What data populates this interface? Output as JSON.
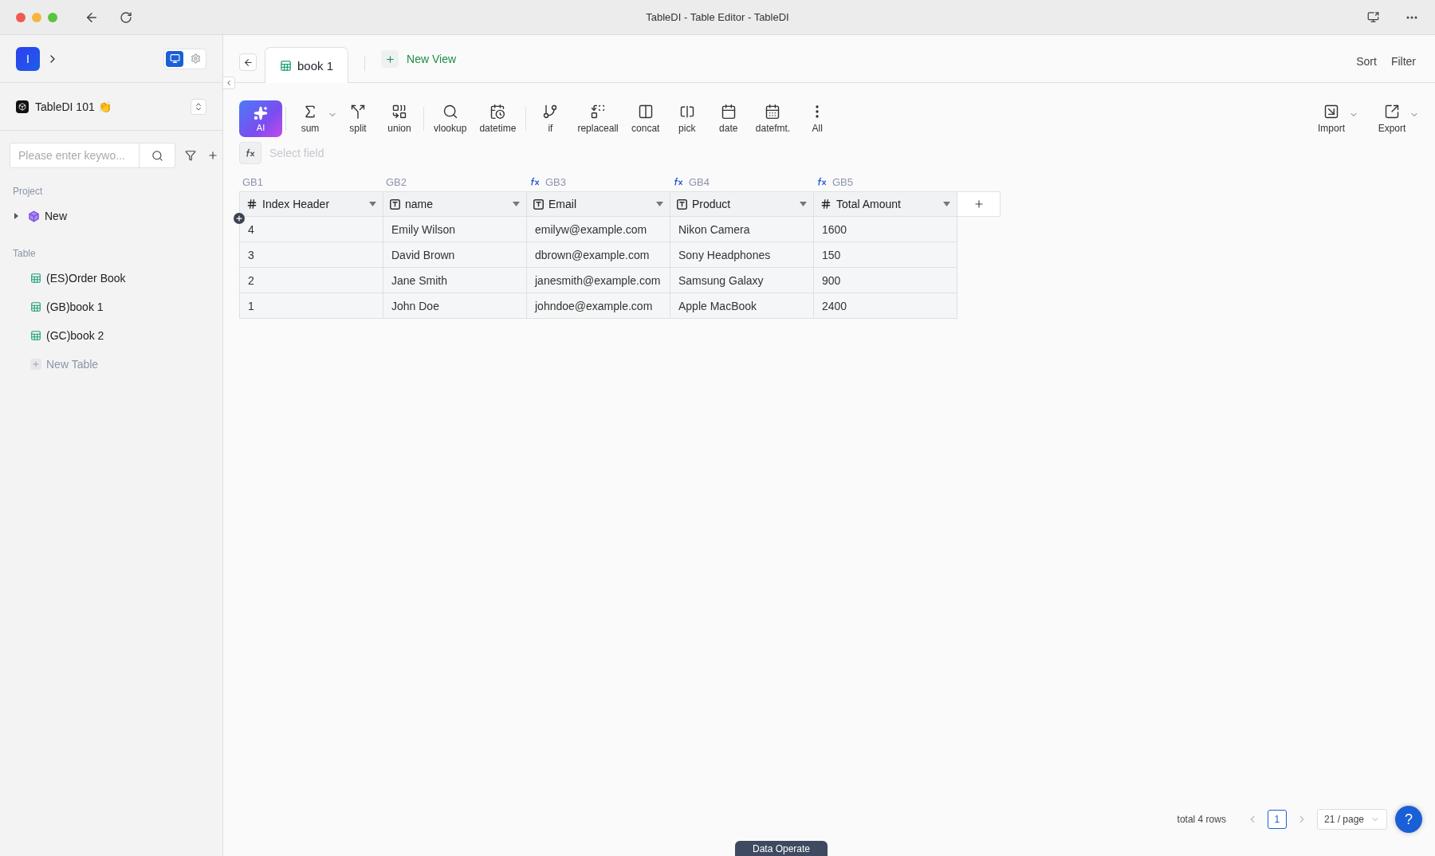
{
  "window": {
    "title": "TableDI - Table Editor - TableDI"
  },
  "sidebar": {
    "workspace": {
      "initial": "I"
    },
    "view_toggle": [
      {
        "selected": true
      },
      {
        "selected": false
      }
    ],
    "project": {
      "name": "TableDI 101 👏"
    },
    "search": {
      "placeholder": "Please enter keywo..."
    },
    "sections": [
      {
        "title": "Project",
        "items": [
          {
            "label": "New",
            "kind": "project",
            "expanded": false
          }
        ]
      },
      {
        "title": "Table",
        "items": [
          {
            "label": "(ES)Order Book",
            "kind": "table"
          },
          {
            "label": "(GB)book 1",
            "kind": "table"
          },
          {
            "label": "(GC)book 2",
            "kind": "table"
          },
          {
            "label": "New Table",
            "kind": "add"
          }
        ]
      }
    ]
  },
  "tabs": [
    {
      "label": "book 1",
      "selected": true
    }
  ],
  "new_view": "New View",
  "header_actions": [
    "Sort",
    "Filter"
  ],
  "toolbar": {
    "ai_label": "AI",
    "tool_groups": [
      [
        {
          "label": "sum",
          "has_menu": true
        },
        {
          "label": "split",
          "has_menu": false
        },
        {
          "label": "union",
          "has_menu": false
        }
      ],
      [
        {
          "label": "vlookup",
          "has_menu": false
        },
        {
          "label": "datetime",
          "has_menu": false
        }
      ],
      [
        {
          "label": "if",
          "has_menu": false
        },
        {
          "label": "replaceall",
          "has_menu": false
        },
        {
          "label": "concat",
          "has_menu": false
        },
        {
          "label": "pick",
          "has_menu": false
        },
        {
          "label": "date",
          "has_menu": false
        },
        {
          "label": "datefmt.",
          "has_menu": false
        },
        {
          "label": "All",
          "has_menu": false
        }
      ]
    ],
    "io": [
      {
        "label": "Import",
        "has_menu": true
      },
      {
        "label": "Export",
        "has_menu": true
      }
    ]
  },
  "formula_bar": {
    "placeholder": "Select field"
  },
  "table": {
    "columns": [
      {
        "code": "GB1",
        "formula": false,
        "kind": "number",
        "label": "Index Header"
      },
      {
        "code": "GB2",
        "formula": false,
        "kind": "text",
        "label": "name"
      },
      {
        "code": "GB3",
        "formula": true,
        "kind": "text",
        "label": "Email"
      },
      {
        "code": "GB4",
        "formula": true,
        "kind": "text",
        "label": "Product"
      },
      {
        "code": "GB5",
        "formula": true,
        "kind": "number",
        "label": "Total Amount"
      }
    ],
    "rows": [
      [
        "4",
        "Emily Wilson",
        "emilyw@example.com",
        "Nikon Camera",
        "1600"
      ],
      [
        "3",
        "David Brown",
        "dbrown@example.com",
        "Sony Headphones",
        "150"
      ],
      [
        "2",
        "Jane Smith",
        "janesmith@example.com",
        "Samsung Galaxy",
        "900"
      ],
      [
        "1",
        "John Doe",
        "johndoe@example.com",
        "Apple MacBook",
        "2400"
      ]
    ]
  },
  "footer": {
    "total": "total 4 rows",
    "pages": [
      {
        "label": "1",
        "selected": true
      }
    ],
    "page_size": "21 / page",
    "help": "?"
  },
  "bottom_tab": "Data Operate"
}
